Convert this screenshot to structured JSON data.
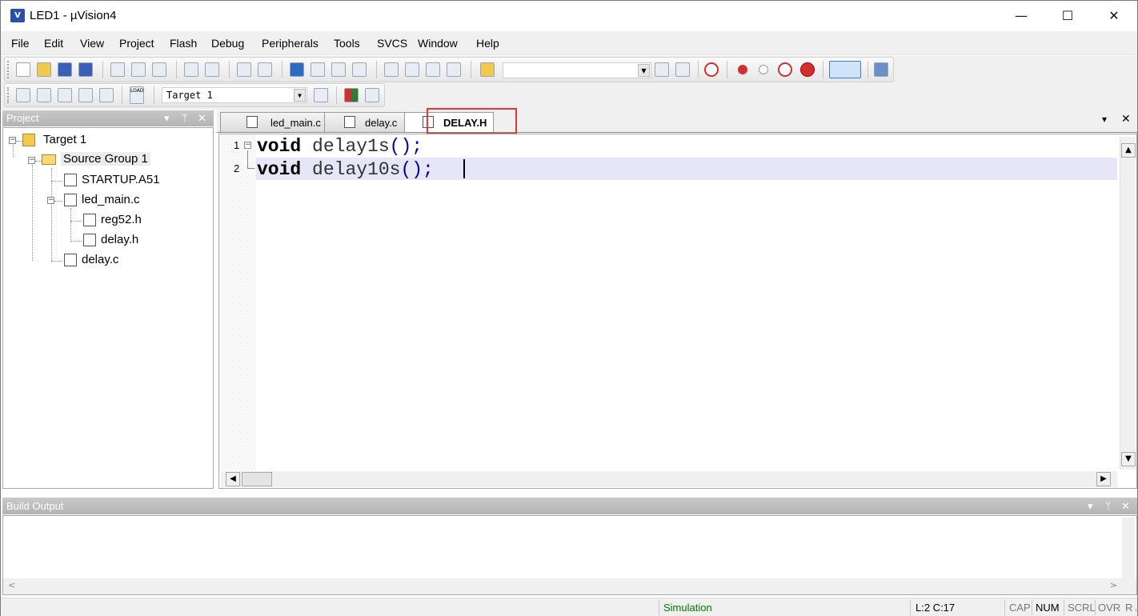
{
  "window": {
    "title": "LED1  - µVision4",
    "app_icon_text": "V",
    "minimize_symbol": "—",
    "maximize_symbol": "☐",
    "close_symbol": "✕"
  },
  "menubar": {
    "items": [
      "File",
      "Edit",
      "View",
      "Project",
      "Flash",
      "Debug",
      "Peripherals",
      "Tools",
      "SVCS",
      "Window",
      "Help"
    ]
  },
  "toolbar": {
    "find_value": "",
    "target_select": "Target 1",
    "icons": [
      "new-file-icon",
      "open-icon",
      "save-icon",
      "save-all-icon",
      "cut-icon",
      "copy-icon",
      "paste-icon",
      "undo-icon",
      "redo-icon",
      "back-icon",
      "forward-icon",
      "bookmark-icon",
      "prev-bookmark-icon",
      "next-bookmark-icon",
      "clear-bookmarks-icon",
      "indent-icon",
      "unindent-icon",
      "comment-icon",
      "uncomment-icon",
      "find-in-files-icon",
      "find-icon",
      "incremental-find-icon",
      "debug-session-icon",
      "breakpoint-icon",
      "disable-breakpoint-icon",
      "disable-all-breakpoints-icon",
      "kill-breakpoints-icon",
      "window-view-icon",
      "configure-icon"
    ],
    "icons2": [
      "translate-icon",
      "build-icon",
      "rebuild-icon",
      "batch-build-icon",
      "stop-build-icon",
      "download-icon",
      "target-options-icon",
      "manage-components-icon",
      "select-packs-icon"
    ],
    "load_label": "LOAD"
  },
  "project_pane": {
    "header": "Project",
    "controls": [
      "▾",
      "ᛘ",
      "✕"
    ],
    "tree": [
      {
        "label": "Target 1"
      },
      {
        "label": "Source Group 1"
      },
      {
        "label": "STARTUP.A51"
      },
      {
        "label": "led_main.c"
      },
      {
        "label": "reg52.h"
      },
      {
        "label": "delay.h"
      },
      {
        "label": "delay.c"
      }
    ]
  },
  "editor": {
    "tabs": [
      {
        "label": "led_main.c",
        "active": false
      },
      {
        "label": "delay.c",
        "active": false
      },
      {
        "label": "DELAY.H",
        "active": true
      }
    ],
    "tabbar_controls": [
      "▾",
      "✕"
    ],
    "lines": [
      {
        "num": "1",
        "keyword": "void",
        "name": "delay1s",
        "punct": "();"
      },
      {
        "num": "2",
        "keyword": "void",
        "name": "delay10s",
        "punct": "();"
      }
    ],
    "highlight_color": "#e53935"
  },
  "build_output": {
    "header": "Build Output",
    "controls": [
      "▾",
      "ᛘ",
      "✕"
    ]
  },
  "statusbar": {
    "mode": "Simulation",
    "mode_color": "#007a00",
    "position": "L:2 C:17",
    "indicators": [
      "CAP",
      "NUM",
      "SCRL",
      "OVR",
      "R /W"
    ]
  }
}
